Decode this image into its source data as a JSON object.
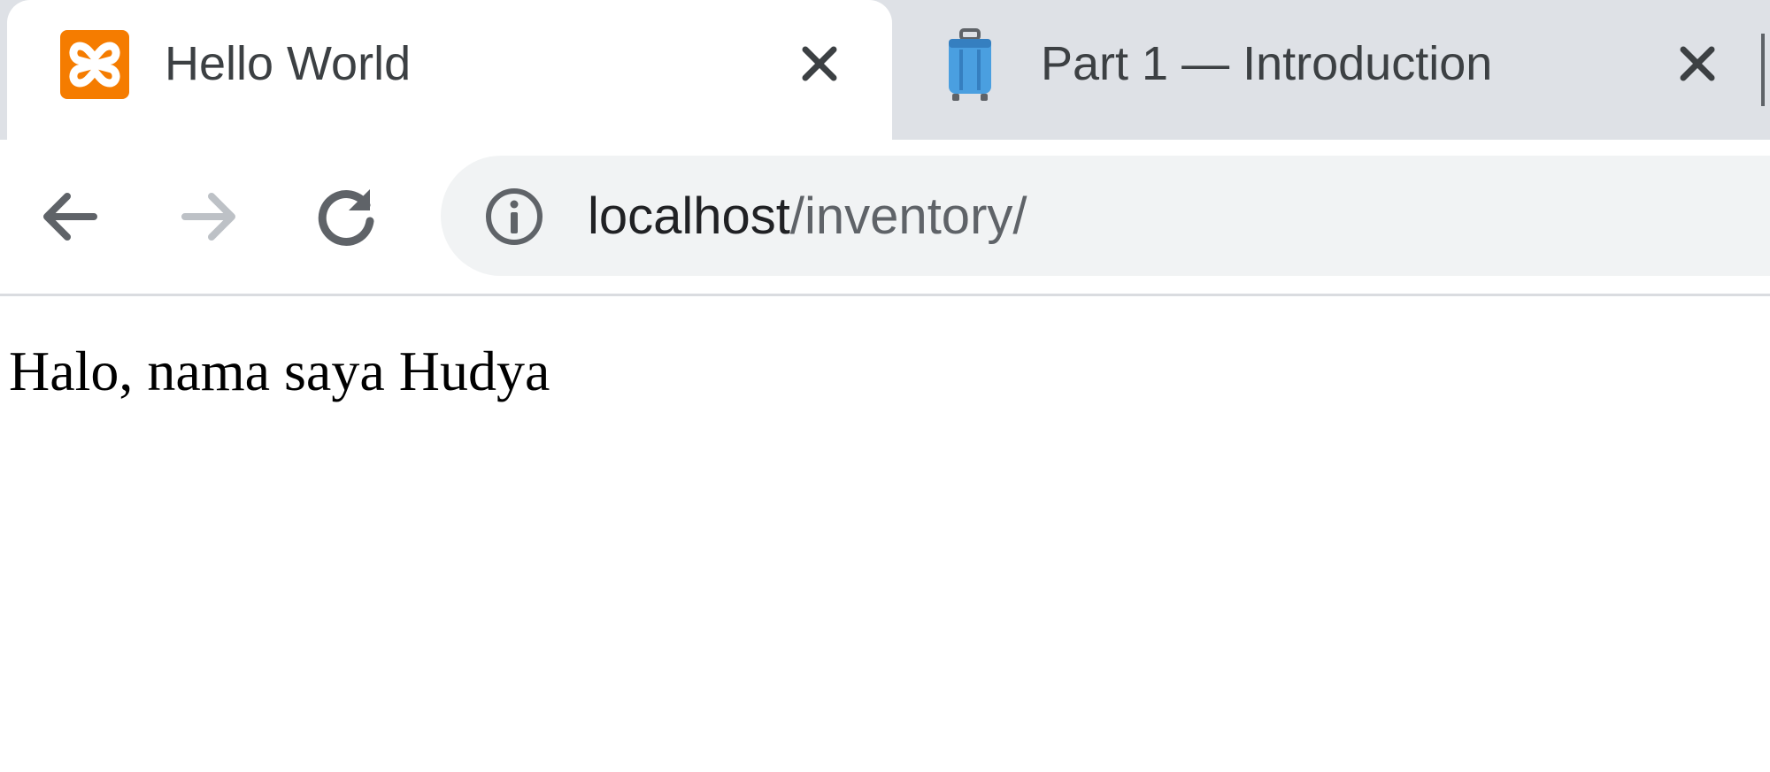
{
  "browser": {
    "tabs": [
      {
        "title": "Hello World",
        "icon": "xampp-icon",
        "active": true,
        "close_label": "Close tab"
      },
      {
        "title": "Part 1 — Introduction",
        "icon": "suitcase-icon",
        "active": false,
        "close_label": "Close tab"
      }
    ],
    "address_bar": {
      "host": "localhost",
      "path": "/inventory/",
      "security_icon": "info-icon"
    },
    "nav": {
      "back_icon": "arrow-left-icon",
      "forward_icon": "arrow-right-icon",
      "reload_icon": "reload-icon"
    }
  },
  "page": {
    "body_text": "Halo, nama saya Hudya"
  },
  "colors": {
    "tabstrip_bg": "#dee1e6",
    "omnibox_bg": "#f1f3f4",
    "xampp_orange": "#f57c00",
    "suitcase_blue": "#4a9fe0",
    "icon_dark": "#5f6368",
    "icon_disabled": "#bdc1c6"
  }
}
